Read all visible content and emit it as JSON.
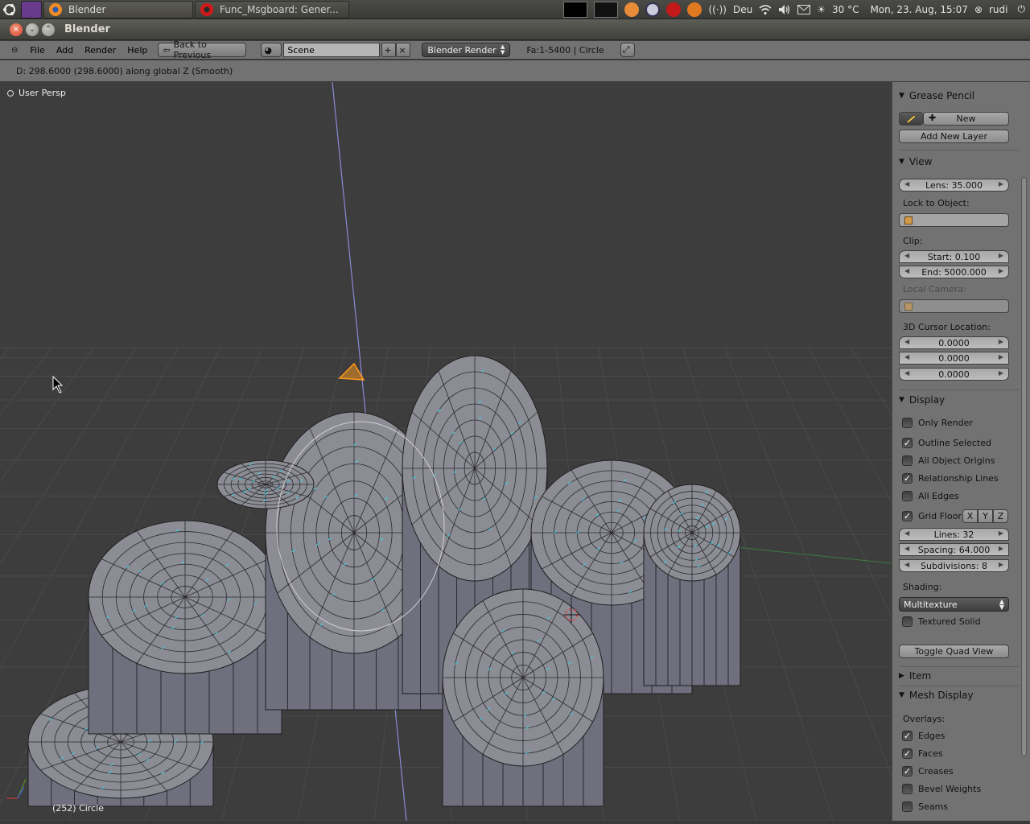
{
  "os_panel": {
    "tasks": [
      {
        "label": "Blender",
        "active": true
      },
      {
        "label": "Func_Msgboard: Gener...",
        "active": false
      }
    ],
    "keyboard_layout": "Deu",
    "weather": "30 °C",
    "clock": "Mon, 23. Aug, 15:07",
    "user": "rudi"
  },
  "window": {
    "title": "Blender"
  },
  "header": {
    "menus": [
      "File",
      "Add",
      "Render",
      "Help"
    ],
    "back_button": "Back to Previous",
    "scene": "Scene",
    "render_engine": "Blender Render",
    "stats": "Fa:1-5400 | Circle"
  },
  "infobar": {
    "text": "D: 298.6000 (298.6000) along global Z (Smooth)"
  },
  "viewport": {
    "label": "User Persp",
    "object_info": "(252) Circle",
    "colors": {
      "background": "#3d3d3d",
      "grid": "#4a4a4a",
      "mesh_face": "#8c8c95",
      "mesh_edge": "#1e1e1e",
      "normals": "#3fd0e0",
      "selected": "#ff9a1c"
    }
  },
  "props": {
    "grease_pencil": {
      "title": "Grease Pencil",
      "new_label": "New",
      "add_layer_label": "Add New Layer"
    },
    "view": {
      "title": "View",
      "lens": "Lens: 35.000",
      "lock_to_object": "Lock to Object:",
      "clip": "Clip:",
      "clip_start": "Start: 0.100",
      "clip_end": "End: 5000.000",
      "local_camera": "Local Camera:",
      "cursor_label": "3D Cursor Location:",
      "cursor": [
        "0.0000",
        "0.0000",
        "0.0000"
      ]
    },
    "display": {
      "title": "Display",
      "options": [
        {
          "label": "Only Render",
          "checked": false
        },
        {
          "label": "Outline Selected",
          "checked": true
        },
        {
          "label": "All Object Origins",
          "checked": false
        },
        {
          "label": "Relationship Lines",
          "checked": true
        },
        {
          "label": "All Edges",
          "checked": false
        },
        {
          "label": "Grid Floor",
          "checked": true
        }
      ],
      "axes": [
        "X",
        "Y",
        "Z"
      ],
      "lines": "Lines: 32",
      "spacing": "Spacing: 64.000",
      "subdivisions": "Subdivisions: 8",
      "shading_label": "Shading:",
      "shading": "Multitexture",
      "textured_solid": {
        "label": "Textured Solid",
        "checked": false
      },
      "toggle_quad": "Toggle Quad View"
    },
    "item": {
      "title": "Item"
    },
    "mesh_display": {
      "title": "Mesh Display",
      "overlays_label": "Overlays:",
      "options": [
        {
          "label": "Edges",
          "checked": true
        },
        {
          "label": "Faces",
          "checked": true
        },
        {
          "label": "Creases",
          "checked": true
        },
        {
          "label": "Bevel Weights",
          "checked": false
        },
        {
          "label": "Seams",
          "checked": false
        }
      ]
    }
  }
}
